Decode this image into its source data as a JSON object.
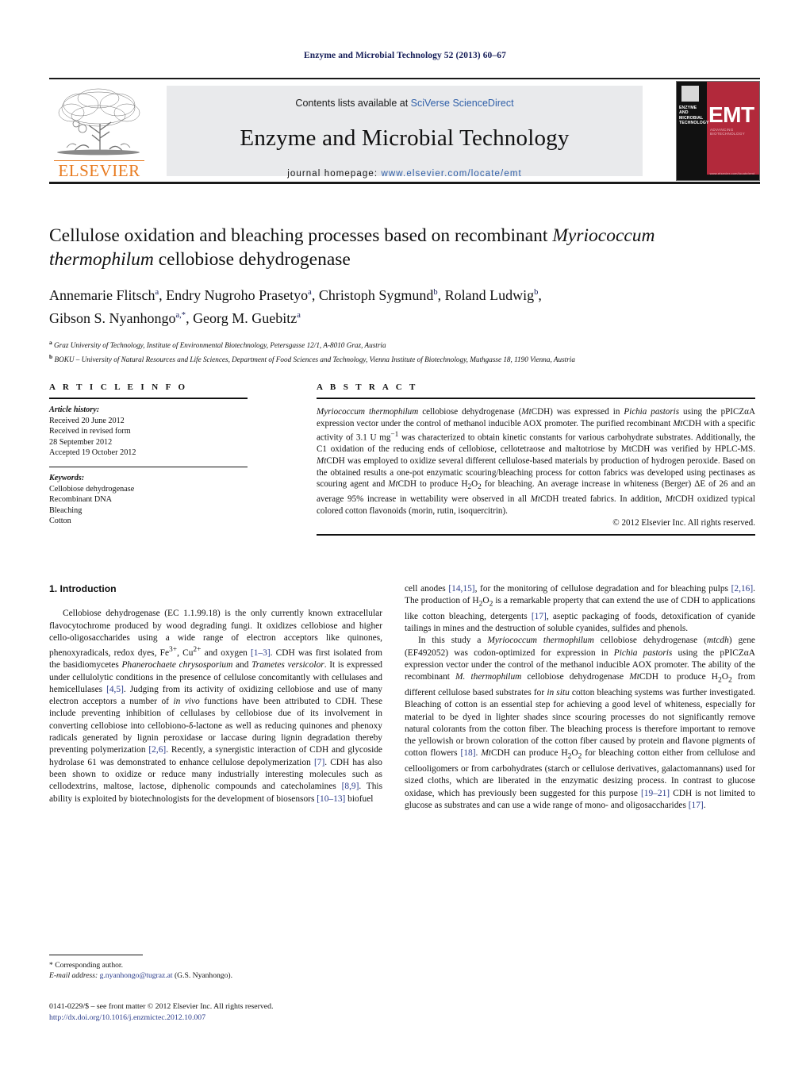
{
  "running_head": "Enzyme and Microbial Technology 52 (2013) 60–67",
  "masthead": {
    "contents_prefix": "Contents lists available at ",
    "sciencedirect": "SciVerse ScienceDirect",
    "journal_title": "Enzyme and Microbial Technology",
    "homepage_label": "journal homepage: ",
    "homepage_url": "www.elsevier.com/locate/emt",
    "publisher_wordmark": "ELSEVIER",
    "cover": {
      "journal_name": "ENZYME AND MICROBIAL TECHNOLOGY",
      "acronym": "EMT",
      "tagline": "ADVANCING BIOTECHNOLOGY",
      "footer_text": "www.elsevier.com/locate/emt"
    },
    "colors": {
      "banner_bg": "#e9eaec",
      "link_blue": "#2f5fa8",
      "elsevier_orange": "#e87a1e",
      "cover_red": "#b2293b"
    }
  },
  "article": {
    "title_part1": "Cellulose oxidation and bleaching processes based on recombinant ",
    "title_species": "Myriococcum thermophilum",
    "title_part2": " cellobiose dehydrogenase",
    "authors_line1": "Annemarie Flitsch",
    "authors_line1_b": ", Endry Nugroho Prasetyo",
    "authors_line1_c": ", Christoph Sygmund",
    "authors_line1_d": ", Roland Ludwig",
    "authors_line2": "Gibson S. Nyanhongo",
    "authors_line2_b": ", Georg M. Guebitz",
    "affiliation_a": "Graz University of Technology, Institute of Environmental Biotechnology, Petersgasse 12/1, A-8010 Graz, Austria",
    "affiliation_b": "BOKU – University of Natural Resources and Life Sciences, Department of Food Sciences and Technology, Vienna Institute of Biotechnology, Muthgasse 18, 1190 Vienna, Austria"
  },
  "article_info": {
    "heading": "A R T I C L E   I N F O",
    "history_label": "Article history:",
    "history_lines": [
      "Received 20 June 2012",
      "Received in revised form",
      "28 September 2012",
      "Accepted 19 October 2012"
    ],
    "keywords_label": "Keywords:",
    "keywords": [
      "Cellobiose dehydrogenase",
      "Recombinant DNA",
      "Bleaching",
      "Cotton"
    ]
  },
  "abstract": {
    "heading": "A B S T R A C T",
    "text_html": "<i>Myriococcum thermophilum</i> cellobiose dehydrogenase (<i>Mt</i>CDH) was expressed in <i>Pichia pastoris</i> using the pPICZ&alpha;A expression vector under the control of methanol inducible AOX promoter. The purified recombinant <i>Mt</i>CDH with a specific activity of 3.1 U mg<sup>−1</sup> was characterized to obtain kinetic constants for various carbohydrate substrates. Additionally, the C1 oxidation of the reducing ends of cellobiose, cellotetraose and maltotriose by MtCDH was verified by HPLC-MS. <i>Mt</i>CDH was employed to oxidize several different cellulose-based materials by production of hydrogen peroxide. Based on the obtained results a one-pot enzymatic scouring/bleaching process for cotton fabrics was developed using pectinases as scouring agent and <i>Mt</i>CDH to produce H<sub>2</sub>O<sub>2</sub> for bleaching. An average increase in whiteness (Berger) &Delta;E of 26 and an average 95% increase in wettability were observed in all <i>Mt</i>CDH treated fabrics. In addition, <i>Mt</i>CDH oxidized typical colored cotton flavonoids (morin, rutin, isoquercitrin).",
    "copyright": "© 2012 Elsevier Inc. All rights reserved."
  },
  "introduction": {
    "heading": "1.  Introduction",
    "left_paragraph_html": "Cellobiose dehydrogenase (EC 1.1.99.18) is the only currently known extracellular flavocytochrome produced by wood degrading fungi. It oxidizes cellobiose and higher cello-oligosaccharides using a wide range of electron acceptors like quinones, phenoxyradicals, redox dyes, Fe<sup>3+</sup>, Cu<sup>2+</sup> and oxygen <span class=\"ref\">[1–3]</span>. CDH was first isolated from the basidiomycetes <i>Phanerochaete chrysosporium</i> and <i>Trametes versicolor</i>. It is expressed under cellulolytic conditions in the presence of cellulose concomitantly with cellulases and hemicellulases <span class=\"ref\">[4,5]</span>. Judging from its activity of oxidizing cellobiose and use of many electron acceptors a number of <i>in vivo</i> functions have been attributed to CDH. These include preventing inhibition of cellulases by cellobiose due of its involvement in converting cellobiose into cellobiono-δ-lactone as well as reducing quinones and phenoxy radicals generated by lignin peroxidase or laccase during lignin degradation thereby preventing polymerization <span class=\"ref\">[2,6]</span>. Recently, a synergistic interaction of CDH and glycoside hydrolase 61 was demonstrated to enhance cellulose depolymerization <span class=\"ref\">[7]</span>. CDH has also been shown to oxidize or reduce many industrially interesting molecules such as cellodextrins, maltose, lactose, diphenolic compounds and catecholamines <span class=\"ref\">[8,9]</span>. This ability is exploited by biotechnologists for the development of biosensors <span class=\"ref\">[10–13]</span> biofuel",
    "right_paragraph1_html": "cell anodes <span class=\"ref\">[14,15]</span>, for the monitoring of cellulose degradation and for bleaching pulps <span class=\"ref\">[2,16]</span>. The production of H<sub>2</sub>O<sub>2</sub> is a remarkable property that can extend the use of CDH to applications like cotton bleaching, detergents <span class=\"ref\">[17]</span>, aseptic packaging of foods, detoxification of cyanide tailings in mines and the destruction of soluble cyanides, sulfides and phenols.",
    "right_paragraph2_html": "In this study a <i>Myriococcum thermophilum</i> cellobiose dehydrogenase (<i>mtcdh</i>) gene (EF492052) was codon-optimized for expression in <i>Pichia pastoris</i> using the pPICZ&alpha;A expression vector under the control of the methanol inducible AOX promoter. The ability of the recombinant <i>M. thermophilum</i> cellobiose dehydrogenase <i>Mt</i>CDH to produce H<sub>2</sub>O<sub>2</sub> from different cellulose based substrates for <i>in situ</i> cotton bleaching systems was further investigated. Bleaching of cotton is an essential step for achieving a good level of whiteness, especially for material to be dyed in lighter shades since scouring processes do not significantly remove natural colorants from the cotton fiber. The bleaching process is therefore important to remove the yellowish or brown coloration of the cotton fiber caused by protein and flavone pigments of cotton flowers <span class=\"ref\">[18]</span>. <i>Mt</i>CDH can produce H<sub>2</sub>O<sub>2</sub> for bleaching cotton either from cellulose and cellooligomers or from carbohydrates (starch or cellulose derivatives, galactomannans) used for sized cloths, which are liberated in the enzymatic desizing process. In contrast to glucose oxidase, which has previously been suggested for this purpose <span class=\"ref\">[19–21]</span> CDH is not limited to glucose as substrates and can use a wide range of mono- and oligosaccharides <span class=\"ref\">[17]</span>."
  },
  "footnotes": {
    "corresponding": "* Corresponding author.",
    "email_label": "E-mail address:",
    "email": "g.nyanhongo@tugraz.at",
    "email_owner": "(G.S. Nyanhongo).",
    "issn_line": "0141-0229/$ – see front matter © 2012 Elsevier Inc. All rights reserved.",
    "doi": "http://dx.doi.org/10.1016/j.enzmictec.2012.10.007"
  }
}
